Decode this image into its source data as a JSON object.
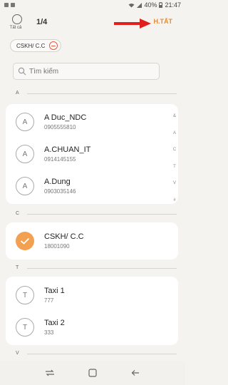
{
  "status": {
    "battery": "40%",
    "time": "21:47"
  },
  "header": {
    "select_all_label": "Tất cả",
    "count": "1/4",
    "done_label": "H.TẤT"
  },
  "chip": {
    "label": "CSKH/ C.C"
  },
  "search": {
    "placeholder": "Tìm kiếm"
  },
  "sections": [
    {
      "letter": "A",
      "contacts": [
        {
          "initial": "A",
          "name": "A Duc_NDC",
          "phone": "0905555810"
        },
        {
          "initial": "A",
          "name": "A.CHUAN_IT",
          "phone": "0914145155"
        },
        {
          "initial": "A",
          "name": "A.Dung",
          "phone": "0903035146"
        }
      ]
    },
    {
      "letter": "C",
      "contacts": [
        {
          "initial": "C",
          "name": "CSKH/ C.C",
          "phone": "18001090",
          "selected": true
        }
      ]
    },
    {
      "letter": "T",
      "contacts": [
        {
          "initial": "T",
          "name": "Taxi 1",
          "phone": "777"
        },
        {
          "initial": "T",
          "name": "Taxi 2",
          "phone": "333"
        }
      ]
    },
    {
      "letter": "V",
      "contacts": []
    }
  ],
  "index": [
    "&",
    "A",
    "C",
    "T",
    "V",
    "#"
  ],
  "colors": {
    "accent": "#e58a2f",
    "selected": "#f2a153",
    "arrow": "#e0201c",
    "remove": "#e25b43"
  }
}
